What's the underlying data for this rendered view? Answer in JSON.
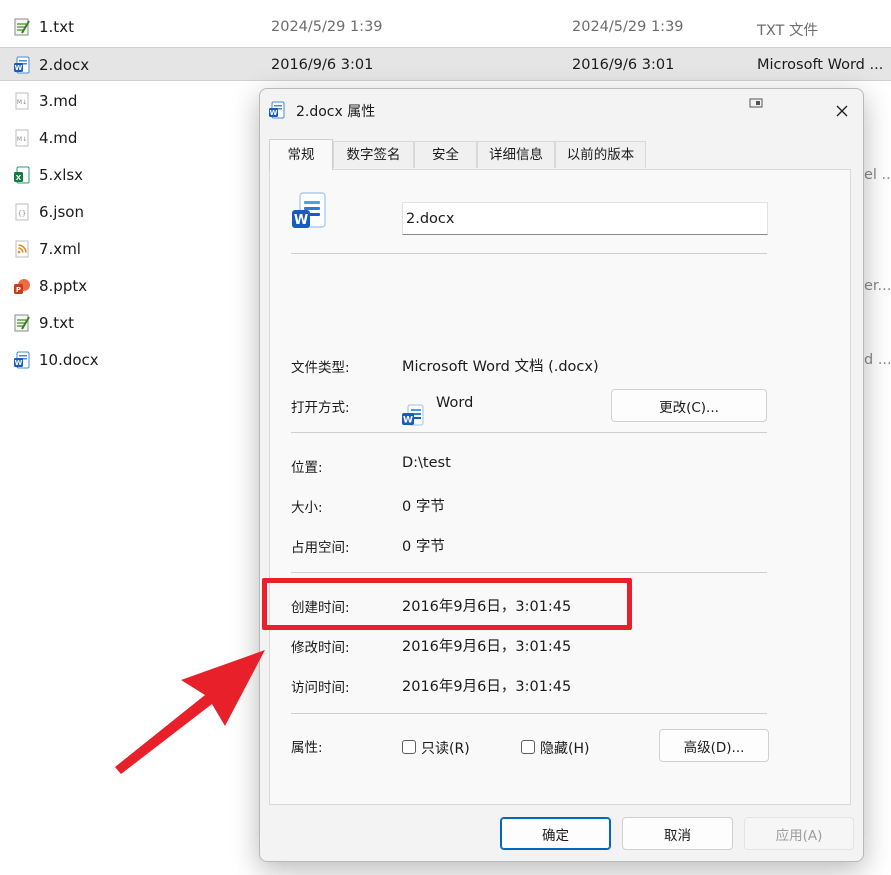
{
  "files": [
    {
      "icon": "txt-file-icon",
      "name": "1.txt",
      "modified": "2024/5/29 1:39",
      "created": "2024/5/29 1:39",
      "type": "TXT 文件"
    },
    {
      "icon": "docx-file-icon",
      "name": "2.docx",
      "modified": "2016/9/6 3:01",
      "created": "2016/9/6 3:01",
      "type": "Microsoft Word ...",
      "selected": true
    },
    {
      "icon": "md-file-icon",
      "name": "3.md"
    },
    {
      "icon": "md-file-icon",
      "name": "4.md"
    },
    {
      "icon": "xlsx-file-icon",
      "name": "5.xlsx"
    },
    {
      "icon": "json-file-icon",
      "name": "6.json"
    },
    {
      "icon": "xml-file-icon",
      "name": "7.xml"
    },
    {
      "icon": "pptx-file-icon",
      "name": "8.pptx"
    },
    {
      "icon": "txt-file-icon",
      "name": "9.txt"
    },
    {
      "icon": "docx-file-icon",
      "name": "10.docx"
    }
  ],
  "type_fragments": [
    "el ...",
    "er...",
    "d ..."
  ],
  "dialog": {
    "title": "2.docx 属性",
    "tabs": [
      "常规",
      "数字签名",
      "安全",
      "详细信息",
      "以前的版本"
    ],
    "active_tab": "常规",
    "file_name": "2.docx",
    "file_type_label": "文件类型:",
    "file_type_value": "Microsoft Word 文档 (.docx)",
    "opens_with_label": "打开方式:",
    "opens_with_value": "Word",
    "change_button": "更改(C)...",
    "location_label": "位置:",
    "location_value": "D:\\test",
    "size_label": "大小:",
    "size_value": "0 字节",
    "size_on_disk_label": "占用空间:",
    "size_on_disk_value": "0 字节",
    "created_label": "创建时间:",
    "created_value": "2016年9月6日，3:01:45",
    "modified_label": "修改时间:",
    "modified_value": "2016年9月6日，3:01:45",
    "accessed_label": "访问时间:",
    "accessed_value": "2016年9月6日，3:01:45",
    "attributes_label": "属性:",
    "readonly_label": "只读(R)",
    "readonly_checked": false,
    "hidden_label": "隐藏(H)",
    "hidden_checked": false,
    "advanced_button": "高级(D)...",
    "ok_button": "确定",
    "cancel_button": "取消",
    "apply_button": "应用(A)"
  },
  "colors": {
    "annotation_red": "#e8202a",
    "word_blue": "#185abd",
    "excel_green": "#107c41",
    "powerpoint_red": "#c43e1c",
    "accent": "#0067c0"
  }
}
